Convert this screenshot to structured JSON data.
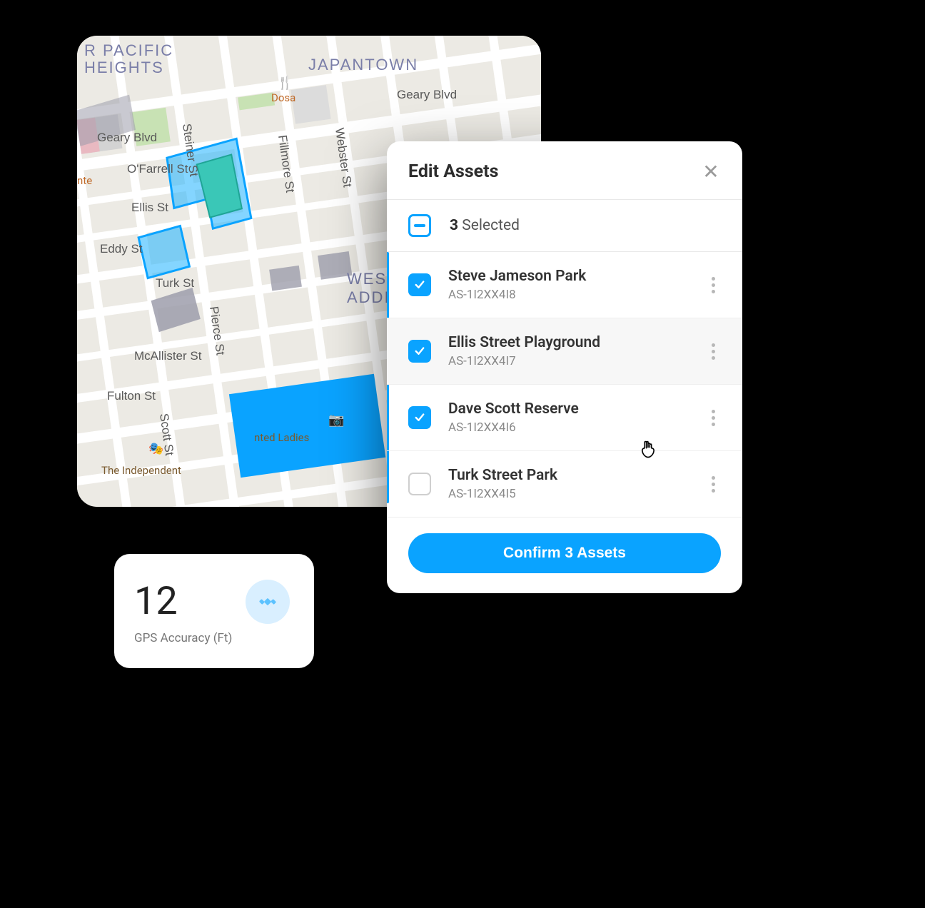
{
  "map": {
    "neighborhoods": {
      "pacific_heights_l1": "R PACIFIC",
      "pacific_heights_l2": "HEIGHTS",
      "japantown": "JAPANTOWN",
      "western_addition_l1": "WEST",
      "western_addition_l2": "ADDI"
    },
    "streets": {
      "geary_top": "Geary Blvd",
      "geary_left": "Geary Blvd",
      "ofarrell": "O'Farrell St",
      "ellis": "Ellis St",
      "eddy": "Eddy St",
      "turk": "Turk St",
      "mcallister": "McAllister St",
      "fulton": "Fulton St",
      "steiner": "Steiner St",
      "pierce": "Pierce St",
      "scott": "Scott St",
      "fillmore": "Fillmore St",
      "webster": "Webster St"
    },
    "poi": {
      "dosa": "Dosa",
      "painted_ladies": "nted Ladies",
      "independent": "The Independent",
      "nte": "nte"
    }
  },
  "gps": {
    "value": "12",
    "label": "GPS Accuracy (Ft)"
  },
  "panel": {
    "title": "Edit Assets",
    "selected_count": "3",
    "selected_suffix": " Selected",
    "confirm_label": "Confirm 3 Assets",
    "assets": [
      {
        "name": "Steve Jameson Park",
        "id": "AS-1I2XX4I8",
        "checked": true,
        "hover": false
      },
      {
        "name": "Ellis Street Playground",
        "id": "AS-1I2XX4I7",
        "checked": true,
        "hover": true
      },
      {
        "name": "Dave Scott Reserve",
        "id": "AS-1I2XX4I6",
        "checked": true,
        "hover": false
      },
      {
        "name": "Turk Street Park",
        "id": "AS-1I2XX4I5",
        "checked": false,
        "hover": false
      }
    ]
  }
}
